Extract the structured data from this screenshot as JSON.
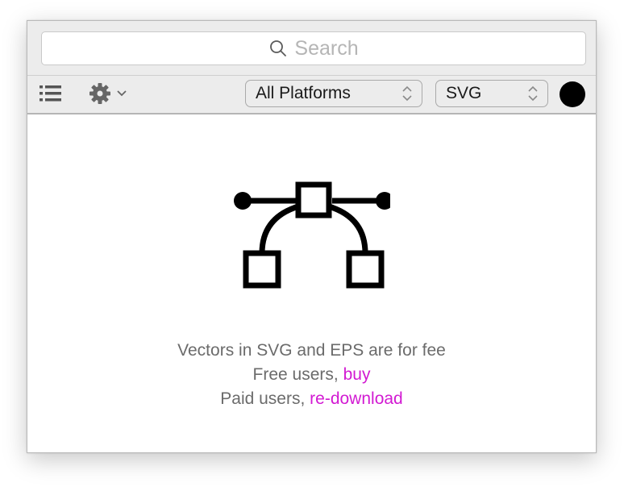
{
  "search": {
    "placeholder": "Search",
    "icon": "magnifier-icon"
  },
  "toolbar": {
    "list_icon": "list-icon",
    "settings_icon": "gear-icon",
    "settings_menu_icon": "chevron-down-icon",
    "platform_select": {
      "selected": "All Platforms",
      "icon": "up-down-arrows-icon"
    },
    "format_select": {
      "selected": "SVG",
      "icon": "up-down-arrows-icon"
    },
    "color_swatch": {
      "color": "#000000"
    }
  },
  "content": {
    "illustration_icon": "bezier-vector-icon",
    "message_line1": "Vectors in SVG and EPS are for fee",
    "message_line2_prefix": "Free users, ",
    "message_line2_link": "buy",
    "message_line3_prefix": "Paid users, ",
    "message_line3_link": "re-download",
    "link_color": "#d21ad2"
  }
}
